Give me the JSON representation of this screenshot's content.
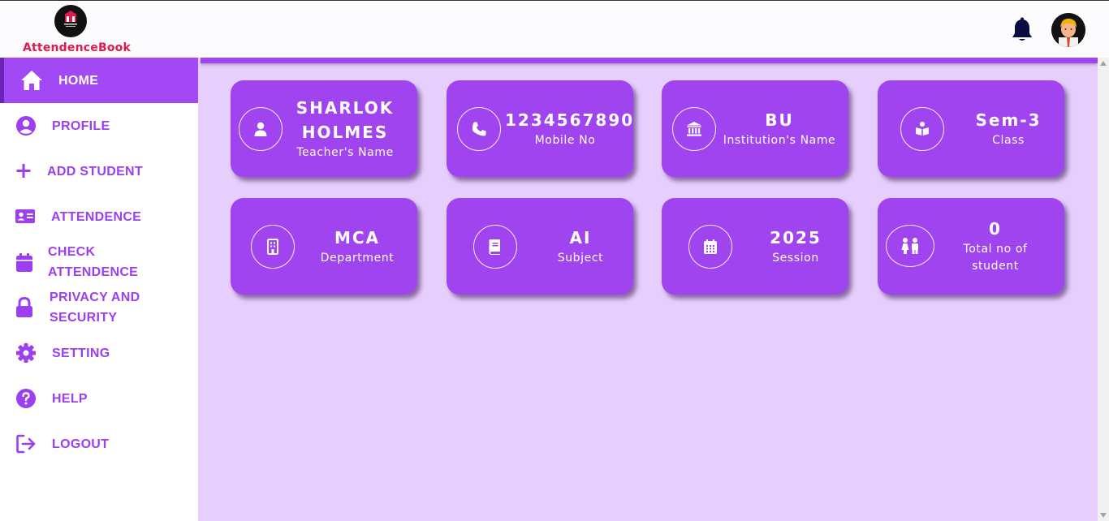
{
  "app": {
    "title": "AttendenceBook"
  },
  "header": {
    "notification_icon": "bell-icon",
    "avatar_icon": "user-avatar"
  },
  "sidebar": {
    "items": [
      {
        "label": "HOME",
        "icon": "home-icon",
        "active": true
      },
      {
        "label": "PROFILE",
        "icon": "user-circle-icon"
      },
      {
        "label": "ADD STUDENT",
        "icon": "plus-icon"
      },
      {
        "label": "ATTENDENCE",
        "icon": "id-card-icon"
      },
      {
        "label": "CHECK\nATTENDENCE",
        "icon": "calendar-icon"
      },
      {
        "label": "PRIVACY AND\nSECURITY",
        "icon": "lock-icon"
      },
      {
        "label": "SETTING",
        "icon": "gear-icon"
      },
      {
        "label": "HELP",
        "icon": "question-icon"
      },
      {
        "label": "LOGOUT",
        "icon": "logout-icon"
      }
    ]
  },
  "cards": [
    {
      "value": "SHARLOK HOLMES",
      "label": "Teacher's Name",
      "icon": "user-icon"
    },
    {
      "value": "1234567890",
      "label": "Mobile No",
      "icon": "phone-icon"
    },
    {
      "value": "BU",
      "label": "Institution's Name",
      "icon": "bank-icon"
    },
    {
      "value": "Sem-3",
      "label": "Class",
      "icon": "book-reader-icon"
    },
    {
      "value": "MCA",
      "label": "Department",
      "icon": "building-icon"
    },
    {
      "value": "AI",
      "label": "Subject",
      "icon": "book-icon"
    },
    {
      "value": "2025",
      "label": "Session",
      "icon": "calendar-icon"
    },
    {
      "value": "0",
      "label": "Total no of student",
      "icon": "children-icon"
    }
  ],
  "colors": {
    "accent": "#a044f0",
    "brand": "#e0194f",
    "background": "#e7cffd"
  }
}
